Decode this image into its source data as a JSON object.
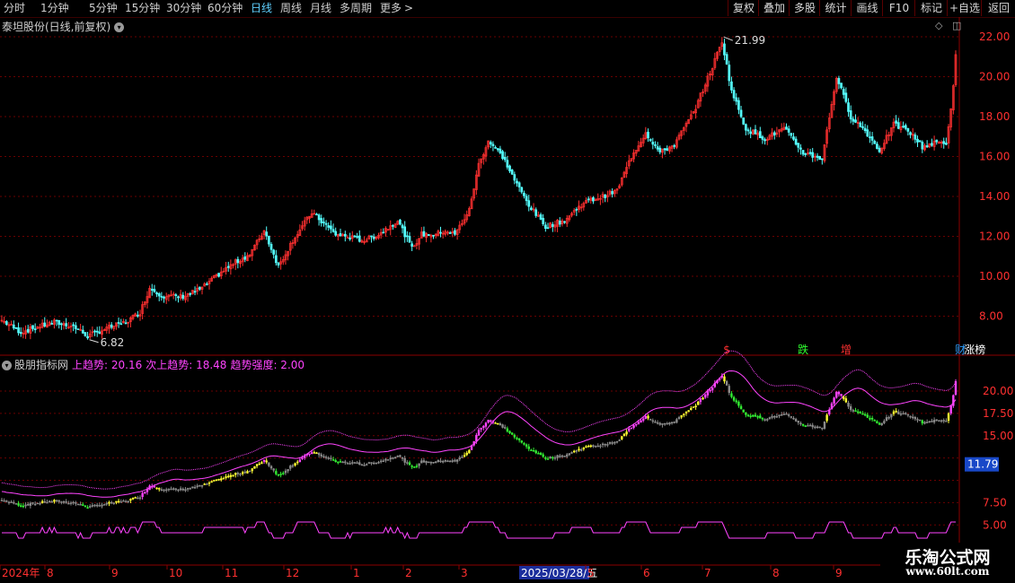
{
  "toolbar": {
    "periods": [
      "分时",
      "1分钟",
      "5分钟",
      "15分钟",
      "30分钟",
      "60分钟",
      "日线",
      "周线",
      "月线",
      "多周期",
      "更多"
    ],
    "active_period": "日线",
    "more_arrow": ">",
    "buttons": [
      "复权",
      "叠加",
      "多股",
      "统计",
      "画线",
      "F10",
      "标记",
      "+自选",
      "返回"
    ]
  },
  "main_panel": {
    "title": "泰坦股份(日线,前复权)",
    "high_label": "21.99",
    "low_label": "6.82",
    "markers": [
      {
        "text": "$",
        "color": "#ff3030",
        "x_index": 157
      },
      {
        "text": "跌",
        "color": "#30ff30",
        "x_index": 173
      },
      {
        "text": "增",
        "color": "#ff3030",
        "x_index": 182
      },
      {
        "text": "财",
        "color": "#30a0ff",
        "x_index": 206
      },
      {
        "text": "涨榜",
        "color": "#ffffff",
        "x_index": 209
      }
    ]
  },
  "indicator_panel": {
    "name": "股朋指标网",
    "label1": "上趋势: 20.16",
    "label2": "次上趋势: 18.48",
    "label3": "趋势强度: 2.00",
    "current_value_badge": "11.79"
  },
  "x_axis": {
    "labels": [
      "2024年",
      "8",
      "9",
      "10",
      "11",
      "12",
      "1",
      "2",
      "3",
      "2025/03/28/五",
      "5",
      "6",
      "7",
      "8",
      "9"
    ],
    "highlighted": "2025/03/28/五"
  },
  "watermark": {
    "line1": "乐淘公式网",
    "line2": "www.60lt.com"
  },
  "colors": {
    "up": "#ff3030",
    "down": "#54ffff",
    "purple": "#ff44ff",
    "yellow": "#ffff33",
    "green": "#33ee33",
    "gray": "#8a8a8a",
    "grid": "#6a0000"
  },
  "chart_data": {
    "type": "candlestick",
    "main_y_ticks": [
      8.0,
      10.0,
      12.0,
      14.0,
      16.0,
      18.0,
      20.0,
      22.0
    ],
    "main_y_tick_labels": [
      "8.00",
      "10.00",
      "12.00",
      "14.00",
      "16.00",
      "18.00",
      "20.00",
      "22.00"
    ],
    "ind_y_ticks": [
      5.0,
      7.5,
      10.0,
      12.5,
      15.0,
      17.5,
      20.0
    ],
    "ind_y_tick_labels": [
      "5.00",
      "7.50",
      "",
      "",
      "15.00",
      "17.50",
      "20.00"
    ],
    "anchors": [
      [
        0,
        7.8
      ],
      [
        8,
        7.2
      ],
      [
        16,
        7.5
      ],
      [
        22,
        7.7
      ],
      [
        30,
        7.5
      ],
      [
        36,
        7.0
      ],
      [
        44,
        7.4
      ],
      [
        52,
        7.7
      ],
      [
        58,
        8.2
      ],
      [
        62,
        9.4
      ],
      [
        68,
        9.0
      ],
      [
        76,
        9.0
      ],
      [
        84,
        9.4
      ],
      [
        92,
        10.2
      ],
      [
        98,
        10.7
      ],
      [
        104,
        11.1
      ],
      [
        110,
        12.3
      ],
      [
        116,
        10.5
      ],
      [
        122,
        11.8
      ],
      [
        130,
        13.2
      ],
      [
        140,
        12.1
      ],
      [
        152,
        11.8
      ],
      [
        158,
        12.1
      ],
      [
        166,
        12.8
      ],
      [
        172,
        11.4
      ],
      [
        176,
        12.1
      ],
      [
        182,
        12.1
      ],
      [
        186,
        12.3
      ],
      [
        190,
        12.1
      ],
      [
        196,
        13.3
      ],
      [
        200,
        15.6
      ],
      [
        204,
        16.8
      ],
      [
        210,
        16.0
      ],
      [
        216,
        14.6
      ],
      [
        222,
        13.4
      ],
      [
        228,
        12.5
      ],
      [
        236,
        12.8
      ],
      [
        244,
        13.7
      ],
      [
        252,
        14.0
      ],
      [
        258,
        14.3
      ],
      [
        264,
        16.0
      ],
      [
        270,
        17.2
      ],
      [
        276,
        16.2
      ],
      [
        282,
        16.6
      ],
      [
        290,
        18.2
      ],
      [
        298,
        20.5
      ],
      [
        302,
        21.8
      ],
      [
        306,
        19.3
      ],
      [
        312,
        17.4
      ],
      [
        320,
        16.9
      ],
      [
        328,
        17.4
      ],
      [
        336,
        16.2
      ],
      [
        344,
        15.9
      ],
      [
        350,
        20.0
      ],
      [
        356,
        18.0
      ],
      [
        362,
        17.3
      ],
      [
        368,
        16.3
      ],
      [
        374,
        17.6
      ],
      [
        380,
        17.3
      ],
      [
        386,
        16.5
      ],
      [
        392,
        16.7
      ],
      [
        396,
        16.7
      ],
      [
        398,
        18.3
      ],
      [
        400,
        21.0
      ]
    ],
    "candles": 401,
    "high": 21.99,
    "low": 6.82,
    "upper_trend_end": 20.16,
    "second_trend_end": 18.48,
    "trend_strength_end": 2.0
  }
}
